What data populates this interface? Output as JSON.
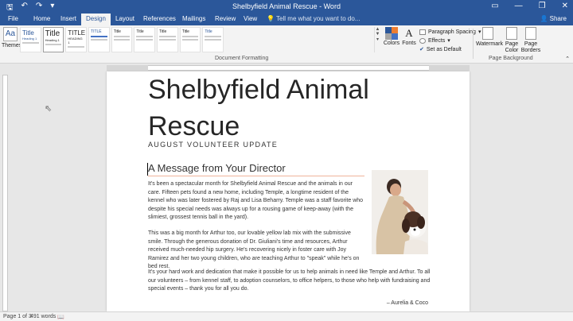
{
  "window": {
    "title": "Shelbyfield Animal Rescue - Word",
    "qat": {
      "save_icon": "save-icon",
      "undo_icon": "undo-icon",
      "redo_icon": "redo-icon",
      "customize_icon": "customize-qat-icon"
    },
    "controls": {
      "ribbon_display_icon": "ribbon-display-icon",
      "minimize": "—",
      "restore": "❐",
      "close": "✕"
    }
  },
  "tabs": [
    {
      "label": "File"
    },
    {
      "label": "Home"
    },
    {
      "label": "Insert"
    },
    {
      "label": "Design"
    },
    {
      "label": "Layout"
    },
    {
      "label": "References"
    },
    {
      "label": "Mailings"
    },
    {
      "label": "Review"
    },
    {
      "label": "View"
    }
  ],
  "active_tab": "Design",
  "tell_me": "Tell me what you want to do...",
  "share": "Share",
  "ribbon": {
    "themes_label": "Themes",
    "style_set_thumbs": [
      {
        "heading": "Title",
        "sub": "Heading 1"
      },
      {
        "heading": "Title",
        "sub": "Heading 1"
      },
      {
        "heading": "TITLE",
        "sub": "HEADING 1"
      },
      {
        "heading": "TITLE",
        "sub": ""
      },
      {
        "heading": "Title",
        "sub": ""
      },
      {
        "heading": "Title",
        "sub": ""
      },
      {
        "heading": "Title",
        "sub": ""
      },
      {
        "heading": "Title",
        "sub": ""
      },
      {
        "heading": "Title",
        "sub": ""
      }
    ],
    "document_formatting_label": "Document Formatting",
    "colors_label": "Colors",
    "fonts_label": "Fonts",
    "paragraph_spacing": "Paragraph Spacing",
    "effects": "Effects",
    "set_as_default": "Set as Default",
    "watermark_label": "Watermark",
    "page_color_label": "Page Color",
    "page_borders_label": "Page Borders",
    "page_background_label": "Page Background",
    "theme_colors": [
      "#2b579a",
      "#ed7d31",
      "#a5a5a5",
      "#4472c4"
    ]
  },
  "document": {
    "title": "Shelbyfield Animal Rescue",
    "subtitle": "AUGUST VOLUNTEER UPDATE",
    "heading": "A Message from Your Director",
    "paragraphs": [
      "It's been a spectacular month for Shelbyfield Animal Rescue and the animals in our care. Fifteen pets found a new home, including Temple, a longtime resident of the kennel who was later fostered by Raj and Lisa Beharry. Temple was a staff favorite who despite his special needs was always up for a rousing game of keep-away (with the slimiest, grossest tennis ball in the yard).",
      "This was a big month for Arthur too, our lovable yellow lab mix with the submissive smile. Through the generous donation of Dr. Giuliani's time and resources, Arthur received much-needed hip surgery. He's recovering nicely in foster care with Joy Ramirez and her two young children, who are teaching Arthur to \"speak\" while he's on bed rest.",
      "It's your hard work and dedication that make it possible for us to help animals in need like Temple and Arthur. To all our volunteers – from kennel staff, to adoption counselors, to office helpers, to those who help with fundraising and special events – thank you for all you do."
    ],
    "signature": "– Aurelia & Coco"
  },
  "status": {
    "page": "Page 1 of 3",
    "words": "491 words",
    "proofing_icon": "proofing-icon"
  },
  "colors": {
    "brand": "#2b579a",
    "heading_rule": "#f0b49a"
  }
}
